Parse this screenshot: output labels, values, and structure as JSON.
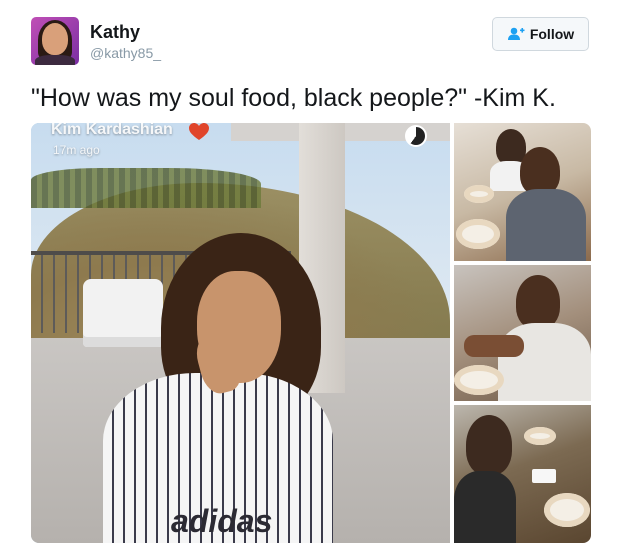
{
  "tweet": {
    "author_name": "Kathy",
    "author_handle": "@kathy85_",
    "follow_label": "Follow",
    "text": "\"How was my soul food, black people?\" -Kim K."
  },
  "media": {
    "main_photo": {
      "snap_username": "Kim Kardashian",
      "snap_time": "17m ago",
      "shirt_text": "adidas"
    }
  },
  "colors": {
    "follow_icon": "#1da1f2",
    "text_primary": "#14171a",
    "text_secondary": "#8899a6"
  }
}
